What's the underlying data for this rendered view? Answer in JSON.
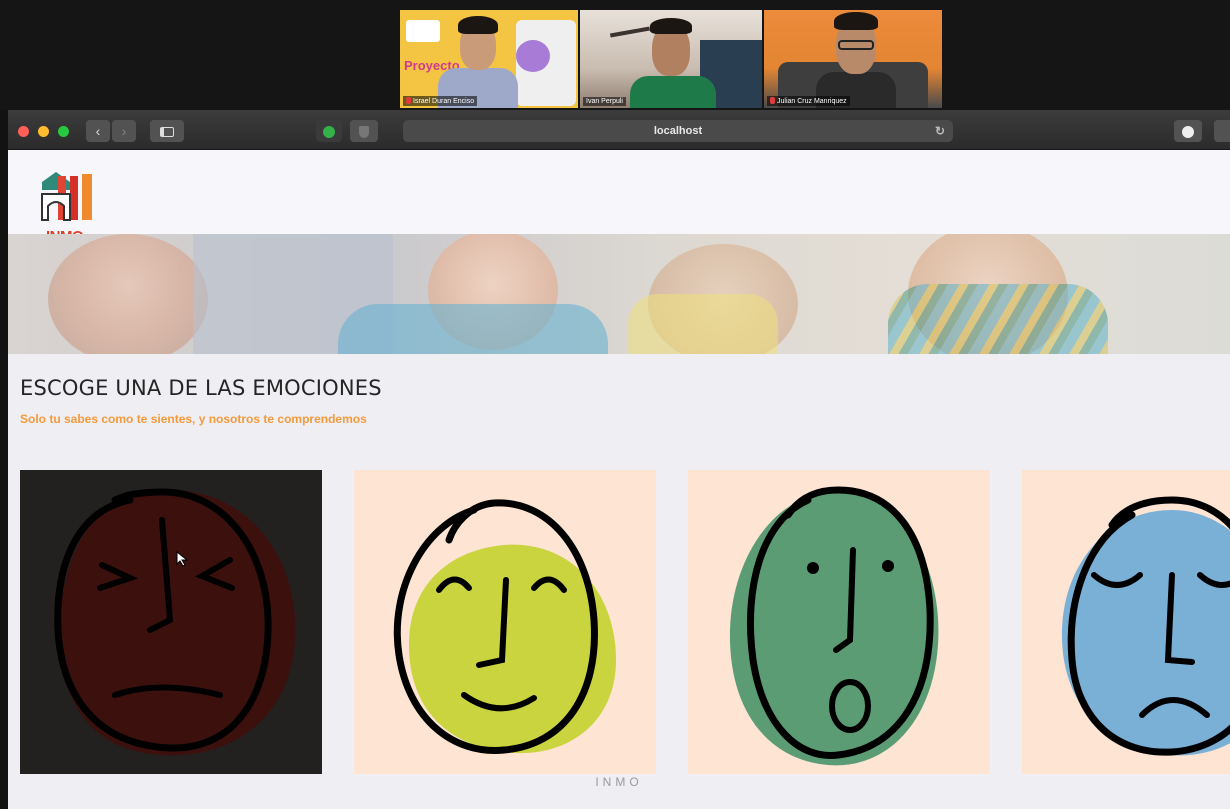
{
  "call": {
    "participants": [
      {
        "name": "Israel Duran Enciso",
        "muted": true
      },
      {
        "name": "Ivan Perpuli",
        "muted": false
      },
      {
        "name": "Julian Cruz Manriquez",
        "muted": true
      }
    ],
    "slide_title": "Proyecto"
  },
  "browser": {
    "url": "localhost",
    "back_icon": "chevron-left-icon",
    "forward_icon": "chevron-right-icon",
    "sidebar_icon": "sidebar-icon",
    "reload_icon": "reload-icon",
    "download_icon": "download-icon"
  },
  "site": {
    "logo_text": "INMO",
    "title": "ESCOGE UNA DE LAS EMOCIONES",
    "subtitle": "Solo tu sabes como te sientes, y nosotros te comprendemos",
    "footer_brand": "INMO"
  },
  "emotions": [
    {
      "name": "angry-face",
      "face_color": "#3c110d",
      "card_bg": "#232020",
      "selected": true
    },
    {
      "name": "happy-face",
      "face_color": "#c9d43e",
      "card_bg": "#fde4d3",
      "selected": false
    },
    {
      "name": "surprised-face",
      "face_color": "#5c9c74",
      "card_bg": "#fde4d3",
      "selected": false
    },
    {
      "name": "sad-face",
      "face_color": "#7aafd6",
      "card_bg": "#fde4d3",
      "selected": false
    }
  ],
  "colors": {
    "accent": "#f39a3b",
    "title": "#252525",
    "page_bg": "#efeef3"
  }
}
